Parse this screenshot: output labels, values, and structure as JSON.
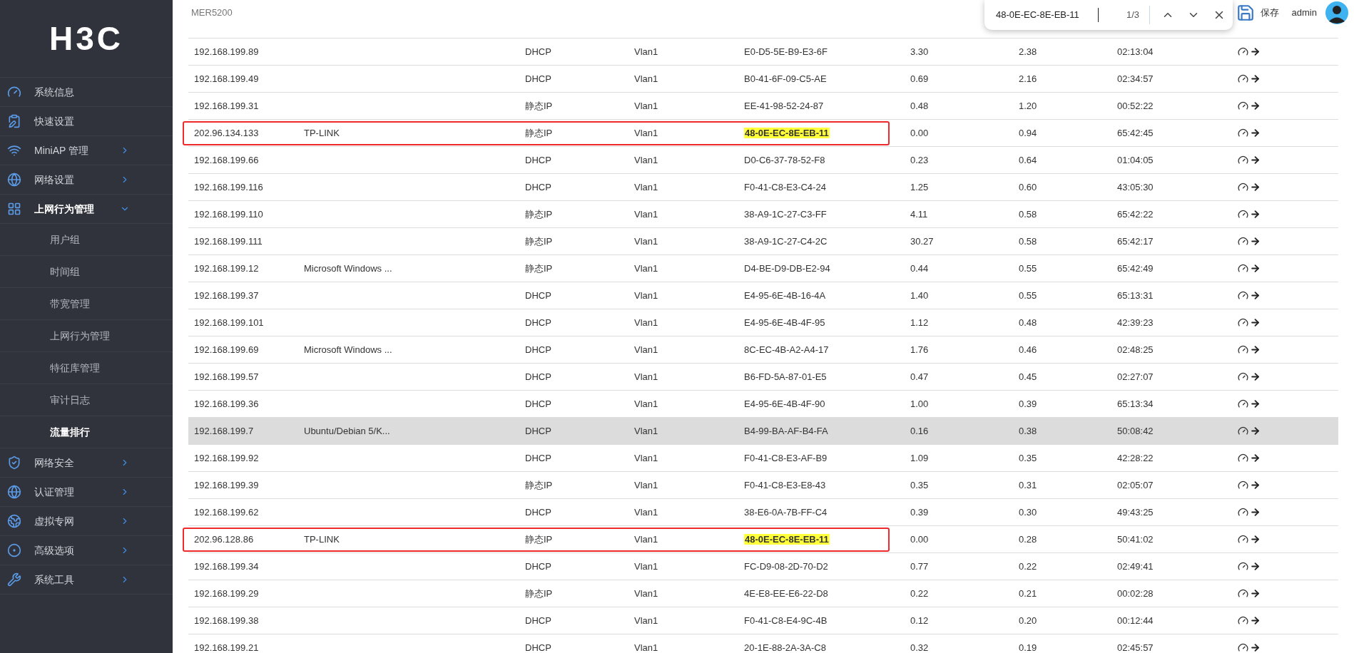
{
  "logo": "H3C",
  "sidebar": {
    "items": [
      {
        "label": "系统信息",
        "kind": "link"
      },
      {
        "label": "快速设置",
        "kind": "link"
      },
      {
        "label": "MiniAP 管理",
        "kind": "menu",
        "expanded": false
      },
      {
        "label": "网络设置",
        "kind": "menu",
        "expanded": false
      },
      {
        "label": "上网行为管理",
        "kind": "menu",
        "expanded": true,
        "children": [
          {
            "label": "用户组",
            "selected": false
          },
          {
            "label": "时间组",
            "selected": false
          },
          {
            "label": "带宽管理",
            "selected": false
          },
          {
            "label": "上网行为管理",
            "selected": false
          },
          {
            "label": "特征库管理",
            "selected": false
          },
          {
            "label": "审计日志",
            "selected": false
          },
          {
            "label": "流量排行",
            "selected": true
          }
        ]
      },
      {
        "label": "网络安全",
        "kind": "menu",
        "expanded": false
      },
      {
        "label": "认证管理",
        "kind": "menu",
        "expanded": false
      },
      {
        "label": "虚拟专网",
        "kind": "menu",
        "expanded": false
      },
      {
        "label": "高级选项",
        "kind": "menu",
        "expanded": false
      },
      {
        "label": "系统工具",
        "kind": "menu",
        "expanded": false
      }
    ]
  },
  "header": {
    "device": "MER5200",
    "save": "保存",
    "user": "admin"
  },
  "find_bar": {
    "value": "48-0E-EC-8E-EB-11",
    "count": "1/3"
  },
  "table": {
    "rows": [
      {
        "column_1": "192.168.199.89",
        "column_2": "",
        "column_3": "DHCP",
        "column_4": "Vlan1",
        "column_5": "E0-D5-5E-B9-E3-6F",
        "column_6": "3.30",
        "column_7": "2.38",
        "column_8": "02:13:04",
        "highlighted": false,
        "outlined": false,
        "match": false
      },
      {
        "column_1": "192.168.199.49",
        "column_2": "",
        "column_3": "DHCP",
        "column_4": "Vlan1",
        "column_5": "B0-41-6F-09-C5-AE",
        "column_6": "0.69",
        "column_7": "2.16",
        "column_8": "02:34:57",
        "highlighted": false,
        "outlined": false,
        "match": false
      },
      {
        "column_1": "192.168.199.31",
        "column_2": "",
        "column_3": "静态IP",
        "column_4": "Vlan1",
        "column_5": "EE-41-98-52-24-87",
        "column_6": "0.48",
        "column_7": "1.20",
        "column_8": "00:52:22",
        "highlighted": false,
        "outlined": false,
        "match": false
      },
      {
        "column_1": "202.96.134.133",
        "column_2": "TP-LINK",
        "column_3": "静态IP",
        "column_4": "Vlan1",
        "column_5": "48-0E-EC-8E-EB-11",
        "column_6": "0.00",
        "column_7": "0.94",
        "column_8": "65:42:45",
        "highlighted": false,
        "outlined": true,
        "match": true
      },
      {
        "column_1": "192.168.199.66",
        "column_2": "",
        "column_3": "DHCP",
        "column_4": "Vlan1",
        "column_5": "D0-C6-37-78-52-F8",
        "column_6": "0.23",
        "column_7": "0.64",
        "column_8": "01:04:05",
        "highlighted": false,
        "outlined": false,
        "match": false
      },
      {
        "column_1": "192.168.199.116",
        "column_2": "",
        "column_3": "DHCP",
        "column_4": "Vlan1",
        "column_5": "F0-41-C8-E3-C4-24",
        "column_6": "1.25",
        "column_7": "0.60",
        "column_8": "43:05:30",
        "highlighted": false,
        "outlined": false,
        "match": false
      },
      {
        "column_1": "192.168.199.110",
        "column_2": "",
        "column_3": "静态IP",
        "column_4": "Vlan1",
        "column_5": "38-A9-1C-27-C3-FF",
        "column_6": "4.11",
        "column_7": "0.58",
        "column_8": "65:42:22",
        "highlighted": false,
        "outlined": false,
        "match": false
      },
      {
        "column_1": "192.168.199.111",
        "column_2": "",
        "column_3": "静态IP",
        "column_4": "Vlan1",
        "column_5": "38-A9-1C-27-C4-2C",
        "column_6": "30.27",
        "column_7": "0.58",
        "column_8": "65:42:17",
        "highlighted": false,
        "outlined": false,
        "match": false
      },
      {
        "column_1": "192.168.199.12",
        "column_2": "Microsoft Windows ...",
        "column_3": "静态IP",
        "column_4": "Vlan1",
        "column_5": "D4-BE-D9-DB-E2-94",
        "column_6": "0.44",
        "column_7": "0.55",
        "column_8": "65:42:49",
        "highlighted": false,
        "outlined": false,
        "match": false
      },
      {
        "column_1": "192.168.199.37",
        "column_2": "",
        "column_3": "DHCP",
        "column_4": "Vlan1",
        "column_5": "E4-95-6E-4B-16-4A",
        "column_6": "1.40",
        "column_7": "0.55",
        "column_8": "65:13:31",
        "highlighted": false,
        "outlined": false,
        "match": false
      },
      {
        "column_1": "192.168.199.101",
        "column_2": "",
        "column_3": "DHCP",
        "column_4": "Vlan1",
        "column_5": "E4-95-6E-4B-4F-95",
        "column_6": "1.12",
        "column_7": "0.48",
        "column_8": "42:39:23",
        "highlighted": false,
        "outlined": false,
        "match": false
      },
      {
        "column_1": "192.168.199.69",
        "column_2": "Microsoft Windows ...",
        "column_3": "DHCP",
        "column_4": "Vlan1",
        "column_5": "8C-EC-4B-A2-A4-17",
        "column_6": "1.76",
        "column_7": "0.46",
        "column_8": "02:48:25",
        "highlighted": false,
        "outlined": false,
        "match": false
      },
      {
        "column_1": "192.168.199.57",
        "column_2": "",
        "column_3": "DHCP",
        "column_4": "Vlan1",
        "column_5": "B6-FD-5A-87-01-E5",
        "column_6": "0.47",
        "column_7": "0.45",
        "column_8": "02:27:07",
        "highlighted": false,
        "outlined": false,
        "match": false
      },
      {
        "column_1": "192.168.199.36",
        "column_2": "",
        "column_3": "DHCP",
        "column_4": "Vlan1",
        "column_5": "E4-95-6E-4B-4F-90",
        "column_6": "1.00",
        "column_7": "0.39",
        "column_8": "65:13:34",
        "highlighted": false,
        "outlined": false,
        "match": false
      },
      {
        "column_1": "192.168.199.7",
        "column_2": "Ubuntu/Debian 5/K...",
        "column_3": "DHCP",
        "column_4": "Vlan1",
        "column_5": "B4-99-BA-AF-B4-FA",
        "column_6": "0.16",
        "column_7": "0.38",
        "column_8": "50:08:42",
        "highlighted": true,
        "outlined": false,
        "match": false
      },
      {
        "column_1": "192.168.199.92",
        "column_2": "",
        "column_3": "DHCP",
        "column_4": "Vlan1",
        "column_5": "F0-41-C8-E3-AF-B9",
        "column_6": "1.09",
        "column_7": "0.35",
        "column_8": "42:28:22",
        "highlighted": false,
        "outlined": false,
        "match": false
      },
      {
        "column_1": "192.168.199.39",
        "column_2": "",
        "column_3": "静态IP",
        "column_4": "Vlan1",
        "column_5": "F0-41-C8-E3-E8-43",
        "column_6": "0.35",
        "column_7": "0.31",
        "column_8": "02:05:07",
        "highlighted": false,
        "outlined": false,
        "match": false
      },
      {
        "column_1": "192.168.199.62",
        "column_2": "",
        "column_3": "DHCP",
        "column_4": "Vlan1",
        "column_5": "38-E6-0A-7B-FF-C4",
        "column_6": "0.39",
        "column_7": "0.30",
        "column_8": "49:43:25",
        "highlighted": false,
        "outlined": false,
        "match": false
      },
      {
        "column_1": "202.96.128.86",
        "column_2": "TP-LINK",
        "column_3": "静态IP",
        "column_4": "Vlan1",
        "column_5": "48-0E-EC-8E-EB-11",
        "column_6": "0.00",
        "column_7": "0.28",
        "column_8": "50:41:02",
        "highlighted": false,
        "outlined": true,
        "match": true
      },
      {
        "column_1": "192.168.199.34",
        "column_2": "",
        "column_3": "DHCP",
        "column_4": "Vlan1",
        "column_5": "FC-D9-08-2D-70-D2",
        "column_6": "0.77",
        "column_7": "0.22",
        "column_8": "02:49:41",
        "highlighted": false,
        "outlined": false,
        "match": false
      },
      {
        "column_1": "192.168.199.29",
        "column_2": "",
        "column_3": "静态IP",
        "column_4": "Vlan1",
        "column_5": "4E-E8-EE-E6-22-D8",
        "column_6": "0.22",
        "column_7": "0.21",
        "column_8": "00:02:28",
        "highlighted": false,
        "outlined": false,
        "match": false
      },
      {
        "column_1": "192.168.199.38",
        "column_2": "",
        "column_3": "DHCP",
        "column_4": "Vlan1",
        "column_5": "F0-41-C8-E4-9C-4B",
        "column_6": "0.12",
        "column_7": "0.20",
        "column_8": "00:12:44",
        "highlighted": false,
        "outlined": false,
        "match": false
      },
      {
        "column_1": "192.168.199.21",
        "column_2": "",
        "column_3": "DHCP",
        "column_4": "Vlan1",
        "column_5": "20-1E-88-2A-3A-C8",
        "column_6": "0.32",
        "column_7": "0.19",
        "column_8": "02:45:57",
        "highlighted": false,
        "outlined": false,
        "match": false
      }
    ]
  }
}
